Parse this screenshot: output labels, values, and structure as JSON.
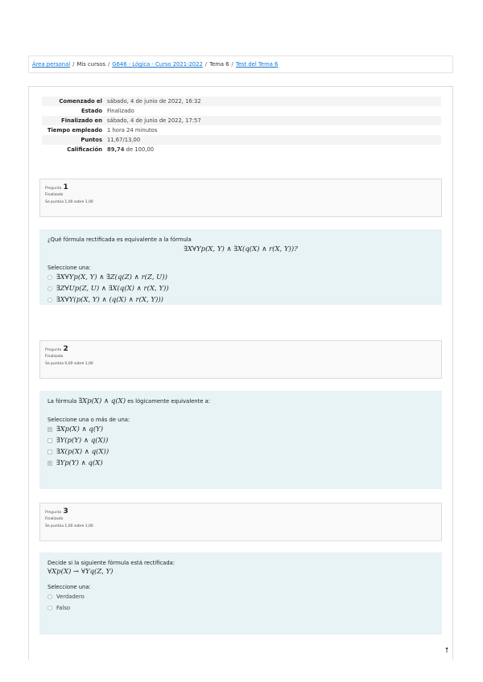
{
  "breadcrumb": {
    "items": [
      {
        "label": "Área personal",
        "link": true
      },
      {
        "label": "Mis cursos",
        "link": false
      },
      {
        "label": "G646 - Lógica - Curso 2021-2022",
        "link": true
      },
      {
        "label": "Tema 6",
        "link": false
      },
      {
        "label": "Test del Tema 6",
        "link": true
      }
    ],
    "separator": "/"
  },
  "summary": [
    {
      "key": "Comenzado el",
      "value": "sábado, 4 de junio de 2022, 16:32"
    },
    {
      "key": "Estado",
      "value": "Finalizado"
    },
    {
      "key": "Finalizado en",
      "value": "sábado, 4 de junio de 2022, 17:57"
    },
    {
      "key": "Tiempo empleado",
      "value": "1 hora 24 minutos"
    },
    {
      "key": "Puntos",
      "value": "11,67/13,00"
    },
    {
      "key": "Calificación",
      "value_bold": "89,74",
      "value_rest": " de 100,00"
    }
  ],
  "questions": [
    {
      "label": "Pregunta",
      "number": "1",
      "state": "Finalizado",
      "grade": "Se puntúa 1,00 sobre 1,00",
      "prompt": "¿Qué fórmula rectificada es equivalente a la fórmula",
      "formula": "∃X∀Yp(X, Y) ∧ ∃X(q(X) ∧ r(X, Y))?",
      "select_label": "Seleccione una:",
      "options": [
        {
          "text": "∃X∀Yp(X, Y) ∧ ∃Z(q(Z) ∧ r(Z, U))",
          "checked": false
        },
        {
          "text": "∃Z∀Up(Z, U) ∧ ∃X(q(X) ∧ r(X, Y))",
          "checked": true
        },
        {
          "text": "∃X∀Y(p(X, Y) ∧ (q(X) ∧ r(X, Y)))",
          "checked": false
        }
      ]
    },
    {
      "label": "Pregunta",
      "number": "2",
      "state": "Finalizado",
      "grade": "Se puntúa 0,00 sobre 1,00",
      "prompt_before": "La fórmula ",
      "prompt_formula": "∃Xp(X) ∧ q(X)",
      "prompt_after": " es lógicamente equivalente a:",
      "select_label": "Seleccione una o más de una:",
      "options": [
        {
          "text": "∃Xp(X) ∧ q(Y)",
          "checked": true
        },
        {
          "text": "∃Y(p(Y) ∧ q(X))",
          "checked": false
        },
        {
          "text": "∃X(p(X) ∧ q(X))",
          "checked": false
        },
        {
          "text": "∃Yp(Y) ∧ q(X)",
          "checked": true
        }
      ]
    },
    {
      "label": "Pregunta",
      "number": "3",
      "state": "Finalizado",
      "grade": "Se puntúa 1,00 sobre 1,00",
      "prompt": "Decide si la siguiente fórmula está rectificada:",
      "formula": "∀Xp(X) → ∀Yq(Z, Y)",
      "select_label": "Seleccione una:",
      "options": [
        {
          "text": "Verdadero",
          "checked": true
        },
        {
          "text": "Falso",
          "checked": false
        }
      ]
    }
  ],
  "scroll_top": {
    "icon": "arrow-up-icon",
    "glyph": "🠕"
  }
}
